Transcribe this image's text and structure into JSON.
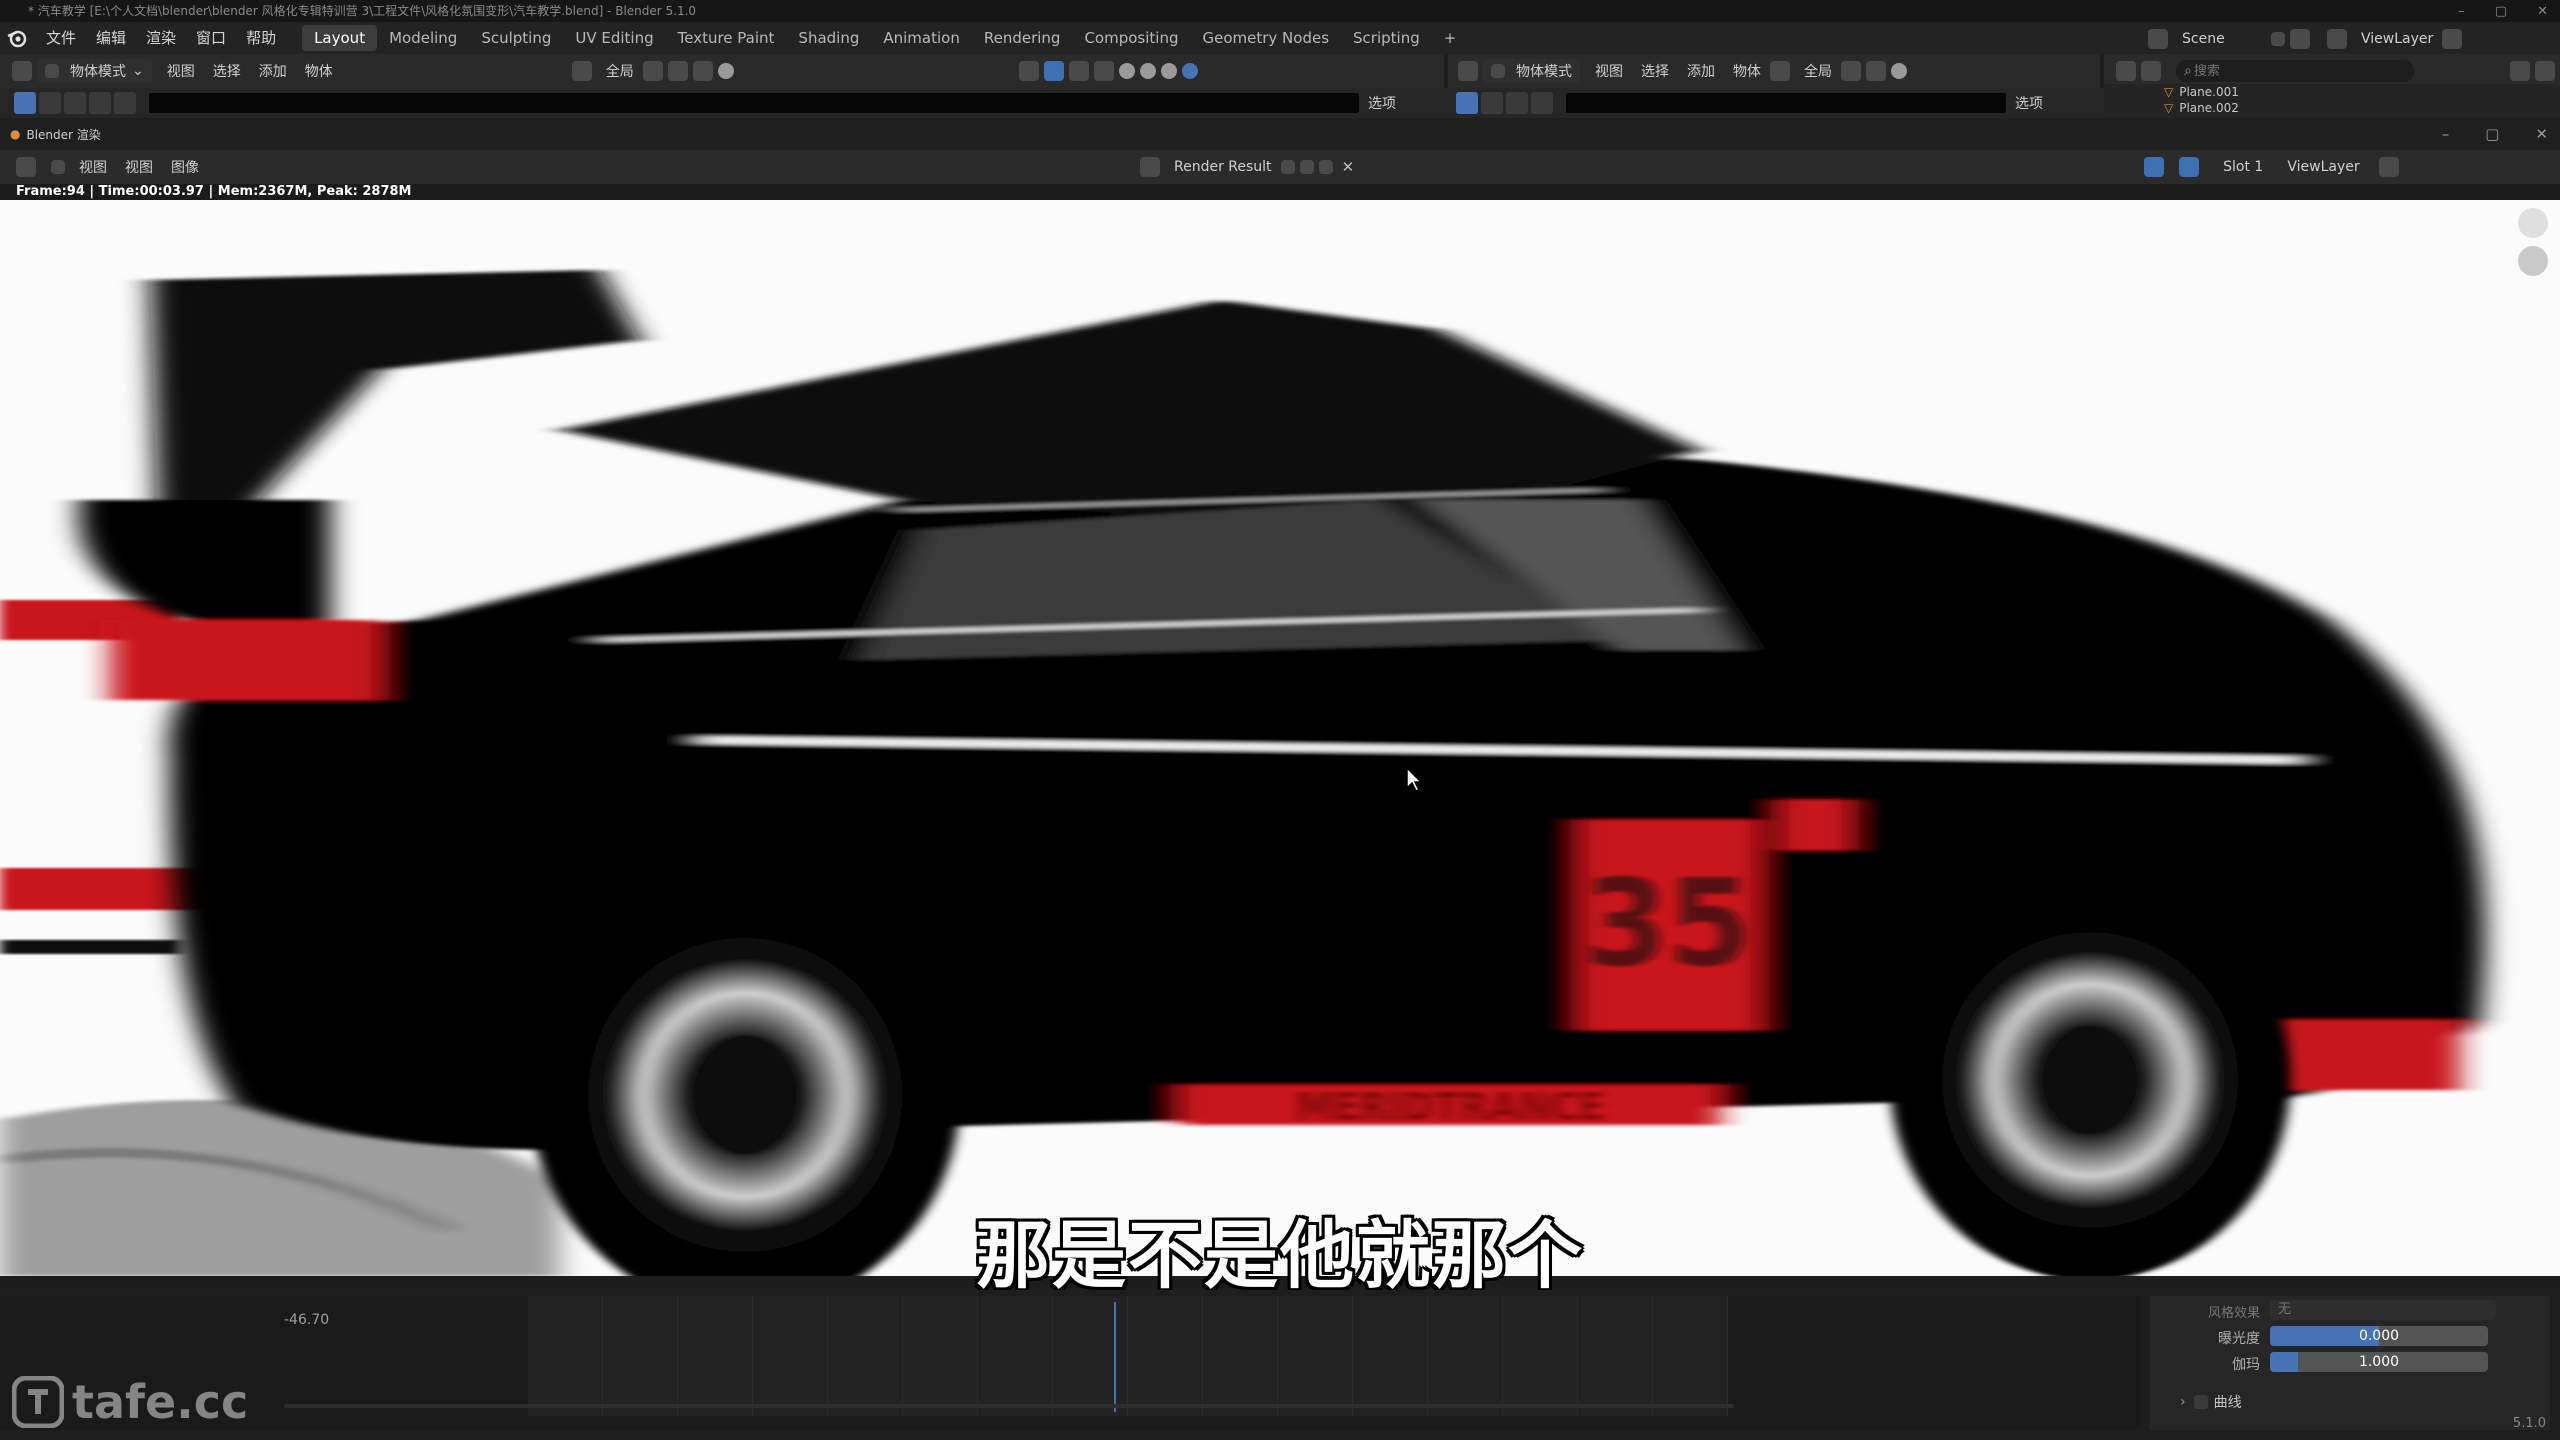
{
  "window": {
    "title": "* 汽车教学 [E:\\个人文档\\blender\\blender 风格化专辑特训营 3\\工程文件\\风格化氛围变形\\汽车教学.blend] - Blender 5.1.0",
    "minimize": "–",
    "maximize": "▢",
    "close": "✕"
  },
  "menus": [
    "文件",
    "编辑",
    "渲染",
    "窗口",
    "帮助"
  ],
  "workspaces": [
    "Layout",
    "Modeling",
    "Sculpting",
    "UV Editing",
    "Texture Paint",
    "Shading",
    "Animation",
    "Rendering",
    "Compositing",
    "Geometry Nodes",
    "Scripting"
  ],
  "workspace_add": "+",
  "scene": {
    "name": "Scene",
    "view_layer": "ViewLayer"
  },
  "left_viewport": {
    "mode": "物体模式",
    "menus": [
      "视图",
      "选择",
      "添加",
      "物体"
    ],
    "transform": "全局",
    "options": "选项"
  },
  "right_viewport": {
    "mode": "物体模式",
    "menus": [
      "视图",
      "选择",
      "添加",
      "物体"
    ],
    "transform": "全局",
    "options": "选项"
  },
  "outliner": {
    "search_placeholder": "搜索",
    "items": [
      "Plane.001",
      "Plane.002"
    ]
  },
  "render_window": {
    "title": "Blender 渲染",
    "menus": [
      "视图",
      "视图",
      "图像"
    ],
    "image_name": "Render Result",
    "slot": "Slot 1",
    "view_layer": "ViewLayer",
    "stats": "Frame:94 | Time:00:03.97 | Mem:2367M, Peak: 2878M"
  },
  "render_text": {
    "number": "35",
    "side_text": "MERIDTRANCE"
  },
  "subtitle": "那是不是他就那个",
  "timeline": {
    "value": "-46.70"
  },
  "color_management": {
    "look_label": "风格效果",
    "look_value": "无",
    "exposure_label": "曝光度",
    "exposure_value": "0.000",
    "exposure_fill": 0.5,
    "gamma_label": "伽玛",
    "gamma_value": "1.000",
    "gamma_fill": 0.13,
    "curves_label": "曲线"
  },
  "version": "5.1.0",
  "watermark": "tafe.cc",
  "colors": {
    "accent": "#4772b3",
    "car_red": "#c8121a"
  }
}
